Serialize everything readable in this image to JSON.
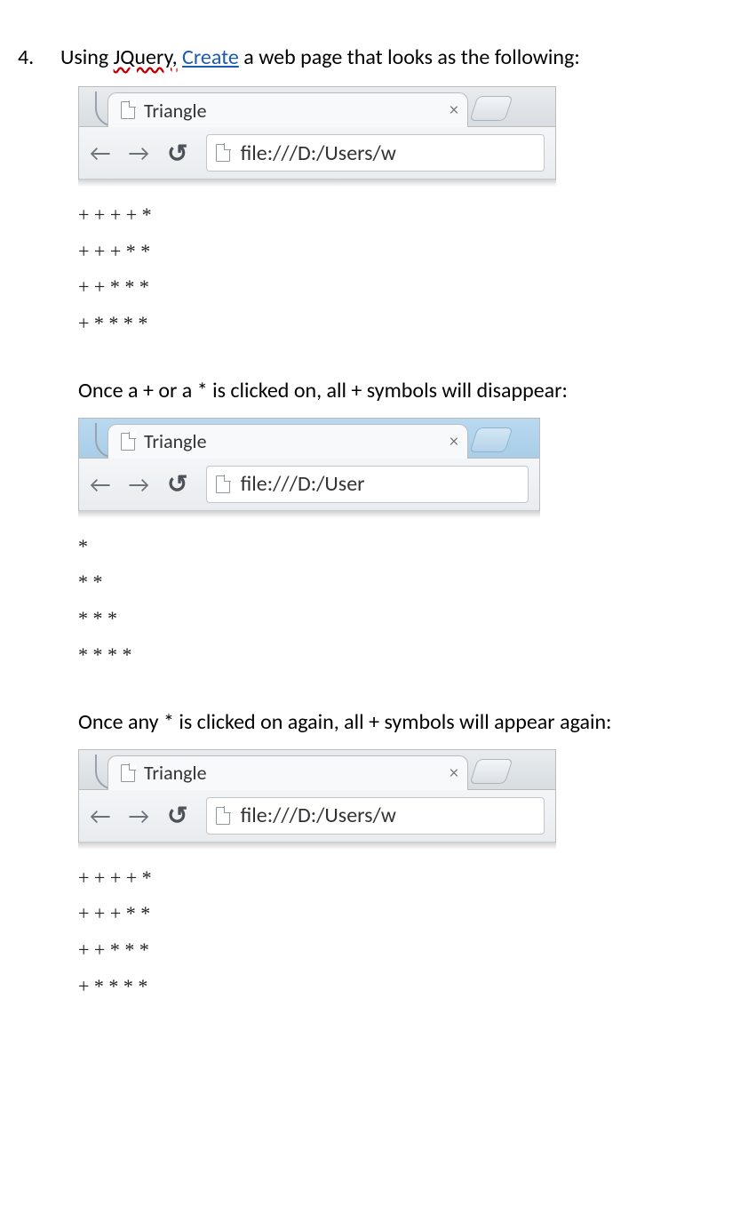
{
  "question": {
    "number": "4.",
    "lead": "Using ",
    "jquery": "JQuery,",
    "space": " ",
    "create": "Create",
    "tail": " a web page that looks as the following:"
  },
  "browser": {
    "tab_title": "Triangle",
    "url_long": "file:///D:/Users/w",
    "url_short": "file:///D:/User"
  },
  "caption1": "Once a + or a * is clicked on, all + symbols will disappear:",
  "caption2": "Once any * is clicked on again, all + symbols will appear again:",
  "pattern_full": "+ + + + *\n+ + + * *\n+ + * * *\n+ * * * *",
  "pattern_stars": "*\n* *\n* * *\n* * * *"
}
